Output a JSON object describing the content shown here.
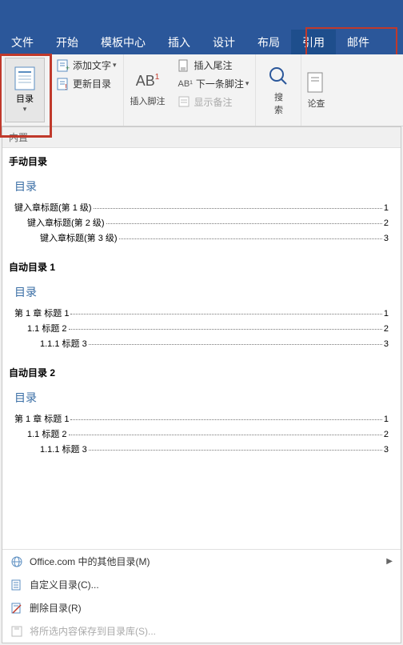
{
  "tabs": {
    "file": "文件",
    "home": "开始",
    "template": "模板中心",
    "insert": "插入",
    "design": "设计",
    "layout": "布局",
    "references": "引用",
    "mail": "邮件"
  },
  "ribbon": {
    "toc": "目录",
    "addText": "添加文字",
    "updateToc": "更新目录",
    "insertFootnote": "插入脚注",
    "insertEndnote": "插入尾注",
    "nextFootnote": "下一条脚注",
    "showNotes": "显示备注",
    "search": "搜索",
    "lookup": "论查"
  },
  "gallery": {
    "builtin": "内置",
    "manual": {
      "label": "手动目录",
      "title": "目录",
      "l1": "键入章标题(第 1 级)",
      "l2": "键入章标题(第 2 级)",
      "l3": "键入章标题(第 3 级)",
      "p1": "1",
      "p2": "2",
      "p3": "3"
    },
    "auto1": {
      "label": "自动目录 1",
      "title": "目录",
      "l1": "第 1 章 标题 1",
      "l2": "1.1 标题 2",
      "l3": "1.1.1 标题 3",
      "p1": "1",
      "p2": "2",
      "p3": "3"
    },
    "auto2": {
      "label": "自动目录 2",
      "title": "目录",
      "l1": "第 1 章 标题 1",
      "l2": "1.1 标题 2",
      "l3": "1.1.1 标题 3",
      "p1": "1",
      "p2": "2",
      "p3": "3"
    },
    "footer": {
      "office": "Office.com 中的其他目录(M)",
      "custom": "自定义目录(C)...",
      "remove": "删除目录(R)",
      "save": "将所选内容保存到目录库(S)..."
    }
  }
}
